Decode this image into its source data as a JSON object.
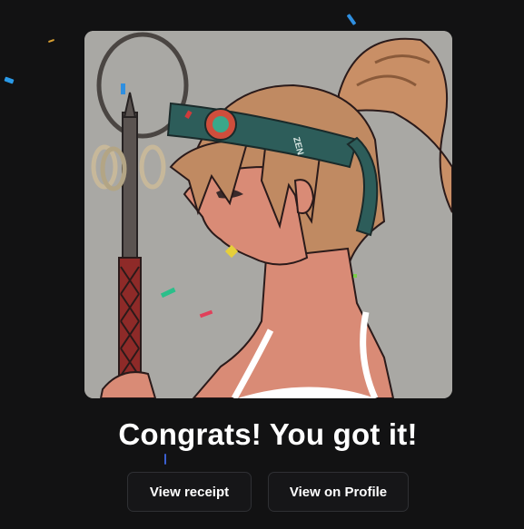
{
  "dialog": {
    "headline": "Congrats! You got it!",
    "artwork": {
      "subject": "anime character",
      "headband_text": "ZEN"
    },
    "buttons": {
      "view_receipt": "View receipt",
      "view_on_profile": "View on Profile"
    }
  },
  "colors": {
    "background": "#121213",
    "button_border": "#2f3034",
    "button_text": "#ffffff",
    "headline_text": "#ffffff",
    "artwork_background": "#a9a8a4"
  }
}
